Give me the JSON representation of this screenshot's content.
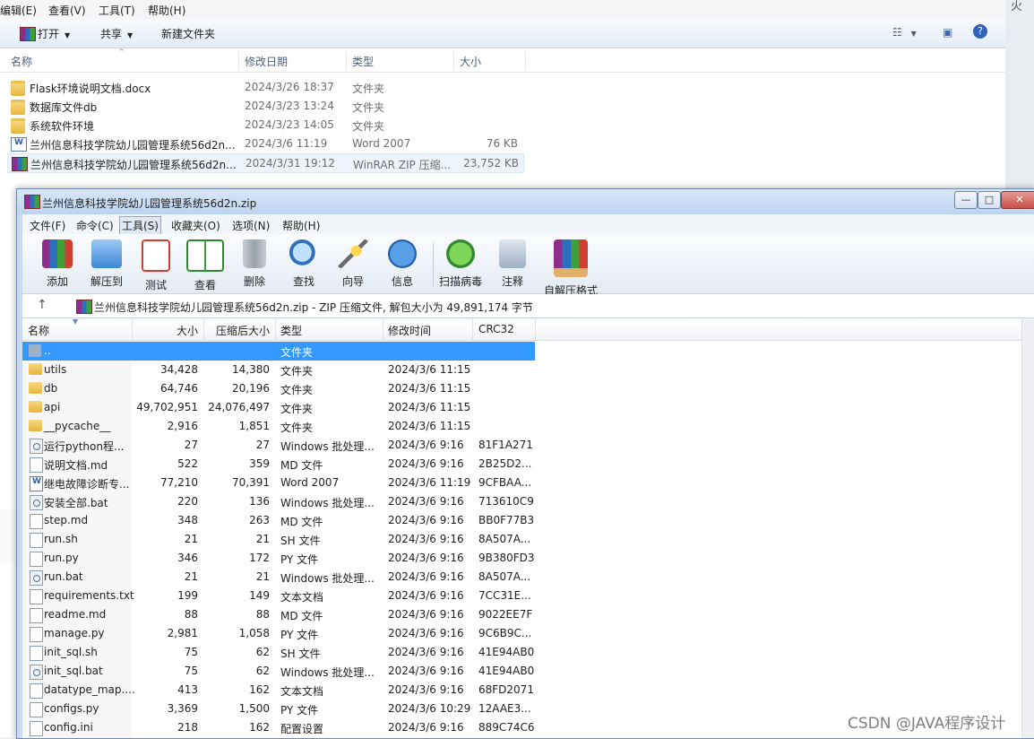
{
  "explorer": {
    "menu": [
      "编辑(E)",
      "查看(V)",
      "工具(T)",
      "帮助(H)"
    ],
    "toolbar": {
      "open": "打开",
      "share": "共享",
      "new_folder": "新建文件夹"
    },
    "columns": {
      "name": "名称",
      "date": "修改日期",
      "type": "类型",
      "size": "大小"
    },
    "files": [
      {
        "name": "Flask环境说明文档.docx",
        "date": "2024/3/26 18:37",
        "type": "文件夹",
        "size": "",
        "icon": "folder-icon"
      },
      {
        "name": "数据库文件db",
        "date": "2024/3/23 13:24",
        "type": "文件夹",
        "size": "",
        "icon": "folder-icon"
      },
      {
        "name": "系统软件环境",
        "date": "2024/3/23 14:05",
        "type": "文件夹",
        "size": "",
        "icon": "folder-icon"
      },
      {
        "name": "兰州信息科技学院幼儿园管理系统56d2n...",
        "date": "2024/3/6 11:19",
        "type": "Word 2007",
        "size": "76 KB",
        "icon": "word-doc-icon"
      },
      {
        "name": "兰州信息科技学院幼儿园管理系统56d2n...",
        "date": "2024/3/31 19:12",
        "type": "WinRAR ZIP 压缩...",
        "size": "23,752 KB",
        "icon": "winrar-archive-icon"
      }
    ],
    "right_fragment": "火"
  },
  "winrar": {
    "title": "兰州信息科技学院幼儿园管理系统56d2n.zip",
    "window_buttons": {
      "minimize": "—",
      "maximize": "□",
      "close": "✕"
    },
    "menu": [
      "文件(F)",
      "命令(C)",
      "工具(S)",
      "收藏夹(O)",
      "选项(N)",
      "帮助(H)"
    ],
    "active_menu_index": 2,
    "tools": [
      {
        "label": "添加",
        "icon": "add-archive-icon"
      },
      {
        "label": "解压到",
        "icon": "extract-to-icon"
      },
      {
        "label": "测试",
        "icon": "test-icon"
      },
      {
        "label": "查看",
        "icon": "view-icon"
      },
      {
        "label": "删除",
        "icon": "delete-icon"
      },
      {
        "label": "查找",
        "icon": "find-icon"
      },
      {
        "label": "向导",
        "icon": "wizard-icon"
      },
      {
        "label": "信息",
        "icon": "info-icon"
      },
      {
        "label": "扫描病毒",
        "icon": "virus-scan-icon"
      },
      {
        "label": "注释",
        "icon": "comment-icon"
      },
      {
        "label": "自解压格式",
        "icon": "sfx-icon"
      }
    ],
    "address": "兰州信息科技学院幼儿园管理系统56d2n.zip - ZIP 压缩文件, 解包大小为 49,891,174 字节",
    "columns": {
      "name": "名称",
      "size": "大小",
      "packed": "压缩后大小",
      "type": "类型",
      "modified": "修改时间",
      "crc": "CRC32"
    },
    "rows": [
      {
        "name": "..",
        "size": "",
        "packed": "",
        "type": "文件夹",
        "modified": "",
        "crc": "",
        "kind": "up"
      },
      {
        "name": "utils",
        "size": "34,428",
        "packed": "14,380",
        "type": "文件夹",
        "modified": "2024/3/6 11:15",
        "crc": "",
        "kind": "dir"
      },
      {
        "name": "db",
        "size": "64,746",
        "packed": "20,196",
        "type": "文件夹",
        "modified": "2024/3/6 11:15",
        "crc": "",
        "kind": "dir"
      },
      {
        "name": "api",
        "size": "49,702,951",
        "packed": "24,076,497",
        "type": "文件夹",
        "modified": "2024/3/6 11:15",
        "crc": "",
        "kind": "dir"
      },
      {
        "name": "__pycache__",
        "size": "2,916",
        "packed": "1,851",
        "type": "文件夹",
        "modified": "2024/3/6 11:15",
        "crc": "",
        "kind": "dir"
      },
      {
        "name": "运行python程...",
        "size": "27",
        "packed": "27",
        "type": "Windows 批处理...",
        "modified": "2024/3/6 9:16",
        "crc": "81F1A271",
        "kind": "bat"
      },
      {
        "name": "说明文档.md",
        "size": "522",
        "packed": "359",
        "type": "MD 文件",
        "modified": "2024/3/6 9:16",
        "crc": "2B25D2...",
        "kind": "file"
      },
      {
        "name": "继电故障诊断专...",
        "size": "77,210",
        "packed": "70,391",
        "type": "Word 2007",
        "modified": "2024/3/6 11:19",
        "crc": "9CFBAA...",
        "kind": "doc"
      },
      {
        "name": "安装全部.bat",
        "size": "220",
        "packed": "136",
        "type": "Windows 批处理...",
        "modified": "2024/3/6 9:16",
        "crc": "713610C9",
        "kind": "bat"
      },
      {
        "name": "step.md",
        "size": "348",
        "packed": "263",
        "type": "MD 文件",
        "modified": "2024/3/6 9:16",
        "crc": "BB0F77B3",
        "kind": "file"
      },
      {
        "name": "run.sh",
        "size": "21",
        "packed": "21",
        "type": "SH 文件",
        "modified": "2024/3/6 9:16",
        "crc": "8A507A...",
        "kind": "file"
      },
      {
        "name": "run.py",
        "size": "346",
        "packed": "172",
        "type": "PY 文件",
        "modified": "2024/3/6 9:16",
        "crc": "9B380FD3",
        "kind": "file"
      },
      {
        "name": "run.bat",
        "size": "21",
        "packed": "21",
        "type": "Windows 批处理...",
        "modified": "2024/3/6 9:16",
        "crc": "8A507A...",
        "kind": "bat"
      },
      {
        "name": "requirements.txt",
        "size": "199",
        "packed": "149",
        "type": "文本文档",
        "modified": "2024/3/6 9:16",
        "crc": "7CC31E...",
        "kind": "file"
      },
      {
        "name": "readme.md",
        "size": "88",
        "packed": "88",
        "type": "MD 文件",
        "modified": "2024/3/6 9:16",
        "crc": "9022EE7F",
        "kind": "file"
      },
      {
        "name": "manage.py",
        "size": "2,981",
        "packed": "1,058",
        "type": "PY 文件",
        "modified": "2024/3/6 9:16",
        "crc": "9C6B9C...",
        "kind": "file"
      },
      {
        "name": "init_sql.sh",
        "size": "75",
        "packed": "62",
        "type": "SH 文件",
        "modified": "2024/3/6 9:16",
        "crc": "41E94AB0",
        "kind": "file"
      },
      {
        "name": "init_sql.bat",
        "size": "75",
        "packed": "62",
        "type": "Windows 批处理...",
        "modified": "2024/3/6 9:16",
        "crc": "41E94AB0",
        "kind": "bat"
      },
      {
        "name": "datatype_map....",
        "size": "413",
        "packed": "162",
        "type": "文本文档",
        "modified": "2024/3/6 9:16",
        "crc": "68FD2071",
        "kind": "file"
      },
      {
        "name": "configs.py",
        "size": "3,369",
        "packed": "1,500",
        "type": "PY 文件",
        "modified": "2024/3/6 10:29",
        "crc": "12AAE3...",
        "kind": "file"
      },
      {
        "name": "config.ini",
        "size": "218",
        "packed": "162",
        "type": "配置设置",
        "modified": "2024/3/6 9:16",
        "crc": "889C74C6",
        "kind": "file"
      }
    ]
  },
  "watermark": "CSDN @JAVA程序设计",
  "colors": {
    "selection": "#3399ff",
    "titlebar": "#bcd3ef",
    "close_button": "#c7504a"
  }
}
